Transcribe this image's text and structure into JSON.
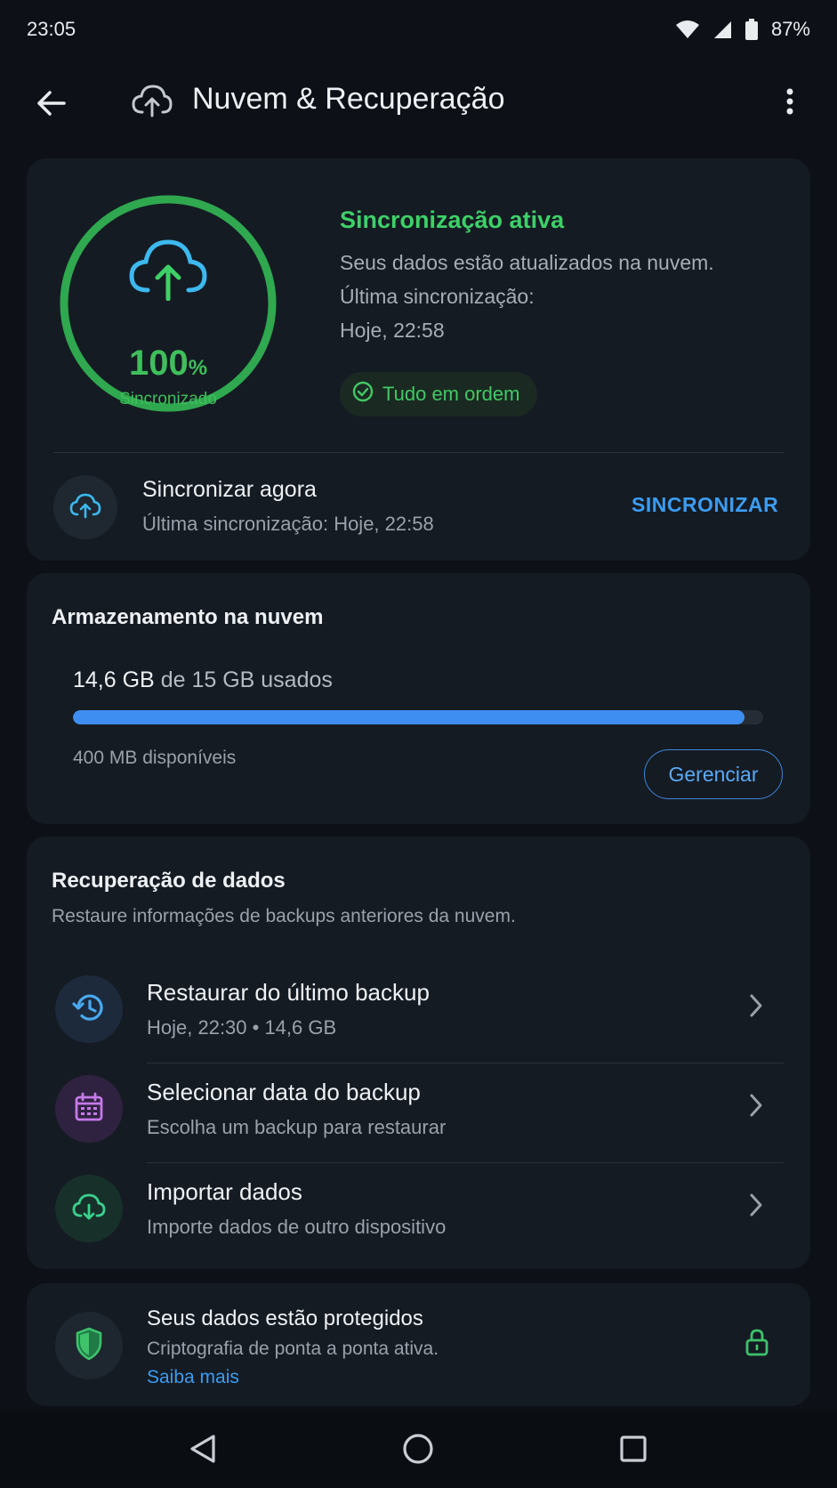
{
  "status_bar": {
    "time": "23:05",
    "battery": "87%"
  },
  "header": {
    "title": "Nuvem & Recuperação"
  },
  "sync": {
    "percent": "100",
    "percent_unit": "%",
    "ring_label": "Sincronizado",
    "progress_fraction": 1.0,
    "status_title": "Sincronização ativa",
    "description": "Seus dados estão atualizados na nuvem.",
    "last_sync_label": "Última sincronização:",
    "last_sync_value": "Hoje, 22:58",
    "badge": "Tudo em ordem",
    "now_title": "Sincronizar agora",
    "now_subtitle": "Última sincronização: Hoje, 22:58",
    "now_button": "SINCRONIZAR"
  },
  "storage": {
    "title": "Armazenamento na nuvem",
    "used": "14,6 GB",
    "total_text": "de 15 GB usados",
    "used_fraction": 0.973,
    "free": "400 MB disponíveis",
    "manage_button": "Gerenciar"
  },
  "recovery": {
    "title": "Recuperação de dados",
    "subtitle": "Restaure informações de backups anteriores da nuvem.",
    "items": [
      {
        "title": "Restaurar do último backup",
        "subtitle": "Hoje, 22:30 • 14,6 GB",
        "icon": "history-icon"
      },
      {
        "title": "Selecionar data do backup",
        "subtitle": "Escolha um backup para restaurar",
        "icon": "calendar-icon"
      },
      {
        "title": "Importar dados",
        "subtitle": "Importe dados de outro dispositivo",
        "icon": "cloud-download-icon"
      }
    ]
  },
  "protection": {
    "title": "Seus dados estão protegidos",
    "subtitle": "Criptografia de ponta a ponta ativa.",
    "link": "Saiba mais"
  },
  "colors": {
    "background": "#0d1117",
    "card": "#151b23",
    "accent_green": "#3ed068",
    "accent_blue": "#3b9cf2",
    "purple": "#c57ae8"
  }
}
